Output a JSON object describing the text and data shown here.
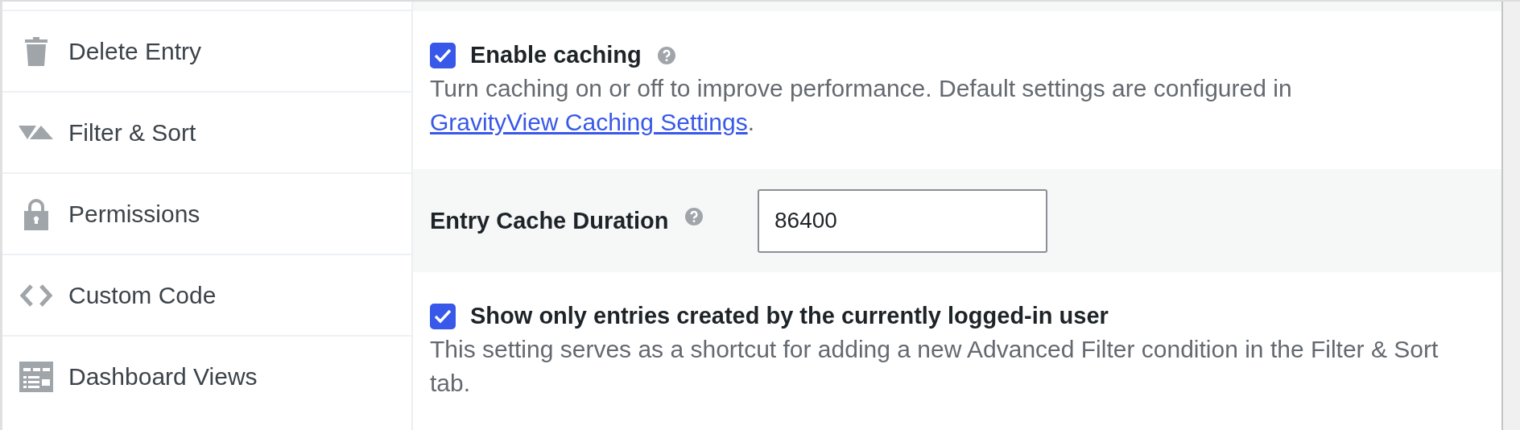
{
  "sidebar": {
    "items": [
      {
        "kind": "trash",
        "label": "Delete Entry"
      },
      {
        "kind": "sort",
        "label": "Filter & Sort"
      },
      {
        "kind": "lock",
        "label": "Permissions"
      },
      {
        "kind": "code",
        "label": "Custom Code"
      },
      {
        "kind": "dashboard",
        "label": "Dashboard Views"
      }
    ]
  },
  "settings": [
    {
      "kind": "checkbox",
      "label": "Enable caching",
      "checked": true,
      "help": true,
      "description": "Turn caching on or off to improve performance. Default settings are configured in ",
      "link": "GravityView Caching Settings",
      "after": "."
    },
    {
      "kind": "number",
      "label": "Entry Cache Duration",
      "help": true,
      "value": "86400"
    },
    {
      "kind": "checkbox",
      "label": "Show only entries created by the currently logged-in user",
      "checked": true,
      "help": false,
      "description": "This setting serves as a shortcut for adding a new Advanced Filter condition in the Filter & Sort tab."
    }
  ]
}
